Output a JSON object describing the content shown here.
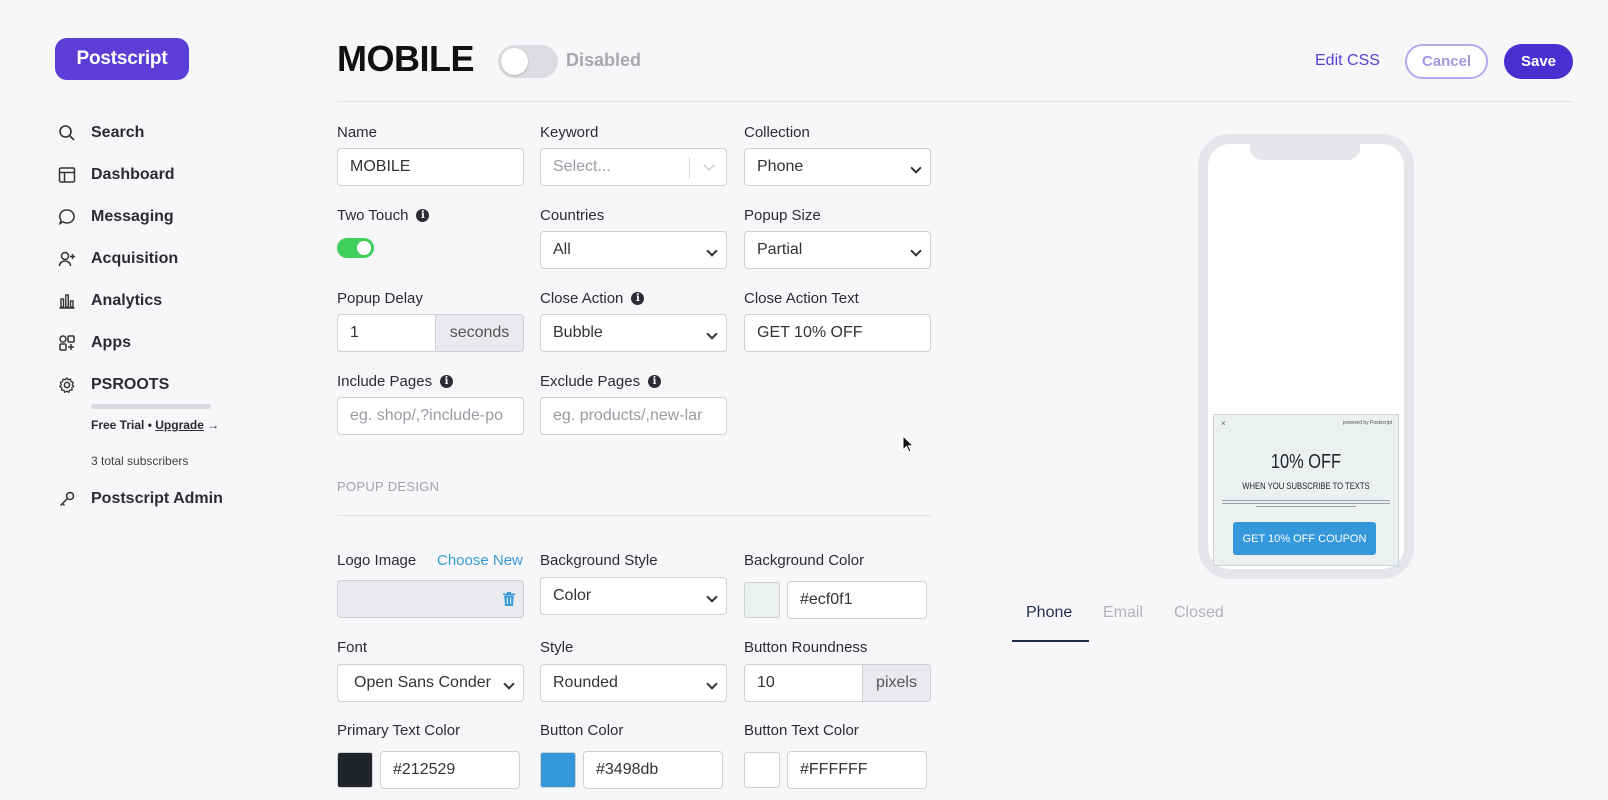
{
  "brand": {
    "logo_text": "Postscript",
    "accent": "#5b3ed6"
  },
  "sidebar": {
    "items": [
      {
        "label": "Search",
        "icon": "search-icon"
      },
      {
        "label": "Dashboard",
        "icon": "dashboard-icon"
      },
      {
        "label": "Messaging",
        "icon": "chat-bubble-icon"
      },
      {
        "label": "Acquisition",
        "icon": "add-user-icon"
      },
      {
        "label": "Analytics",
        "icon": "bar-chart-icon"
      },
      {
        "label": "Apps",
        "icon": "apps-icon"
      },
      {
        "label": "PSROOTS",
        "icon": "gear-icon"
      }
    ],
    "trial_text": "Free Trial •",
    "upgrade_label": "Upgrade",
    "upgrade_arrow": "→",
    "subscribers": "3 total subscribers",
    "admin_label": "Postscript Admin"
  },
  "header": {
    "title": "MOBILE",
    "status": "Disabled",
    "enabled": false,
    "edit_css": "Edit CSS",
    "cancel": "Cancel",
    "save": "Save"
  },
  "form": {
    "name": {
      "label": "Name",
      "value": "MOBILE"
    },
    "keyword": {
      "label": "Keyword",
      "placeholder": "Select..."
    },
    "collection": {
      "label": "Collection",
      "value": "Phone"
    },
    "two_touch": {
      "label": "Two Touch",
      "enabled": true
    },
    "countries": {
      "label": "Countries",
      "value": "All"
    },
    "popup_size": {
      "label": "Popup Size",
      "value": "Partial"
    },
    "popup_delay": {
      "label": "Popup Delay",
      "value": "1",
      "unit": "seconds"
    },
    "close_action": {
      "label": "Close Action",
      "value": "Bubble"
    },
    "close_action_text": {
      "label": "Close Action Text",
      "value": "GET 10% OFF"
    },
    "include_pages": {
      "label": "Include Pages",
      "placeholder": "eg. shop/,?include-po"
    },
    "exclude_pages": {
      "label": "Exclude Pages",
      "placeholder": "eg. products/,new-lar"
    },
    "section_title": "POPUP DESIGN",
    "logo_image": {
      "label": "Logo Image",
      "action": "Choose New"
    },
    "background_style": {
      "label": "Background Style",
      "value": "Color"
    },
    "background_color": {
      "label": "Background Color",
      "value": "#ecf0f1"
    },
    "font": {
      "label": "Font",
      "value": "Open Sans Conder"
    },
    "style": {
      "label": "Style",
      "value": "Rounded"
    },
    "button_roundness": {
      "label": "Button Roundness",
      "value": "10",
      "unit": "pixels"
    },
    "primary_text_color": {
      "label": "Primary Text Color",
      "value": "#212529"
    },
    "button_color": {
      "label": "Button Color",
      "value": "#3498db"
    },
    "button_text_color": {
      "label": "Button Text Color",
      "value": "#FFFFFF"
    },
    "info_glyph": "i"
  },
  "preview": {
    "close_glyph": "×",
    "powered_by": "powered by Postscript",
    "headline": "10% OFF",
    "subhead": "WHEN YOU SUBSCRIBE TO TEXTS",
    "cta": "GET 10% OFF COUPON",
    "tabs": [
      "Phone",
      "Email",
      "Closed"
    ],
    "active_tab": "Phone"
  }
}
